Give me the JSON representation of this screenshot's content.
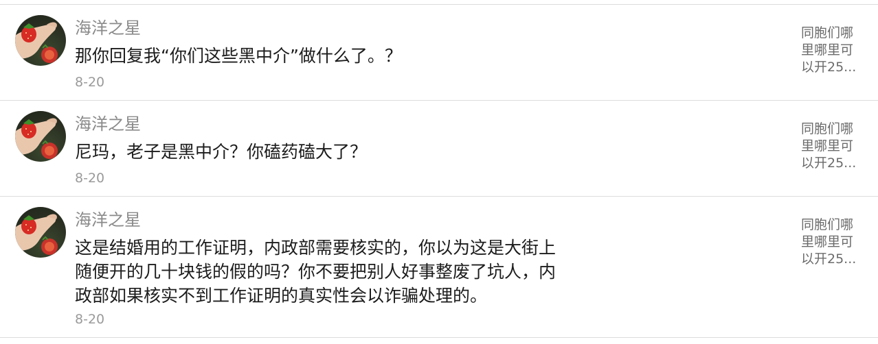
{
  "comments": [
    {
      "user": "海洋之星",
      "message": "那你回复我“你们这些黑中介”做什么了。？",
      "date": "8-20",
      "preview_lines": [
        "同胞们哪",
        "里哪里可",
        "以开25..."
      ]
    },
    {
      "user": "海洋之星",
      "message": "尼玛，老子是黑中介？你磕药磕大了？",
      "date": "8-20",
      "preview_lines": [
        "同胞们哪",
        "里哪里可",
        "以开25..."
      ]
    },
    {
      "user": "海洋之星",
      "message_lines": [
        "这是结婚用的工作证明，内政部需要核实的，你以为这是大街上",
        "随便开的几十块钱的假的吗？你不要把别人好事整废了坑人，内",
        "政部如果核实不到工作证明的真实性会以诈骗处理的。"
      ],
      "date": "8-20",
      "preview_lines": [
        "同胞们哪",
        "里哪里可",
        "以开25..."
      ]
    }
  ],
  "colors": {
    "divider": "#dcdcdc",
    "username": "#8a8a8a",
    "message": "#1c1c1c",
    "date": "#9a9a9a",
    "preview": "#6b6b6b"
  },
  "icons": {
    "avatar": "avatar-hand-strawberry"
  }
}
